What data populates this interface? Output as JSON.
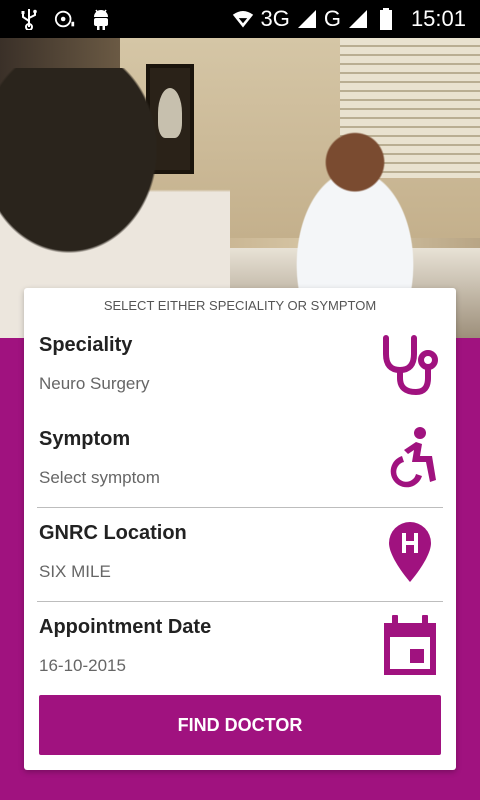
{
  "status_bar": {
    "network_3g": "3G",
    "network_g": "G",
    "time": "15:01"
  },
  "form": {
    "hint": "SELECT EITHER SPECIALITY OR SYMPTOM",
    "speciality": {
      "label": "Speciality",
      "value": "Neuro Surgery",
      "icon": "stethoscope-icon"
    },
    "symptom": {
      "label": "Symptom",
      "value": "Select symptom",
      "icon": "wheelchair-icon"
    },
    "location": {
      "label": "GNRC Location",
      "value": "SIX MILE",
      "icon": "hospital-pin-icon"
    },
    "date": {
      "label": "Appointment Date",
      "value": "16-10-2015",
      "icon": "calendar-icon"
    },
    "submit_label": "FIND DOCTOR"
  },
  "colors": {
    "brand": "#a0127f",
    "status_bar": "#000000",
    "card": "#ffffff"
  }
}
